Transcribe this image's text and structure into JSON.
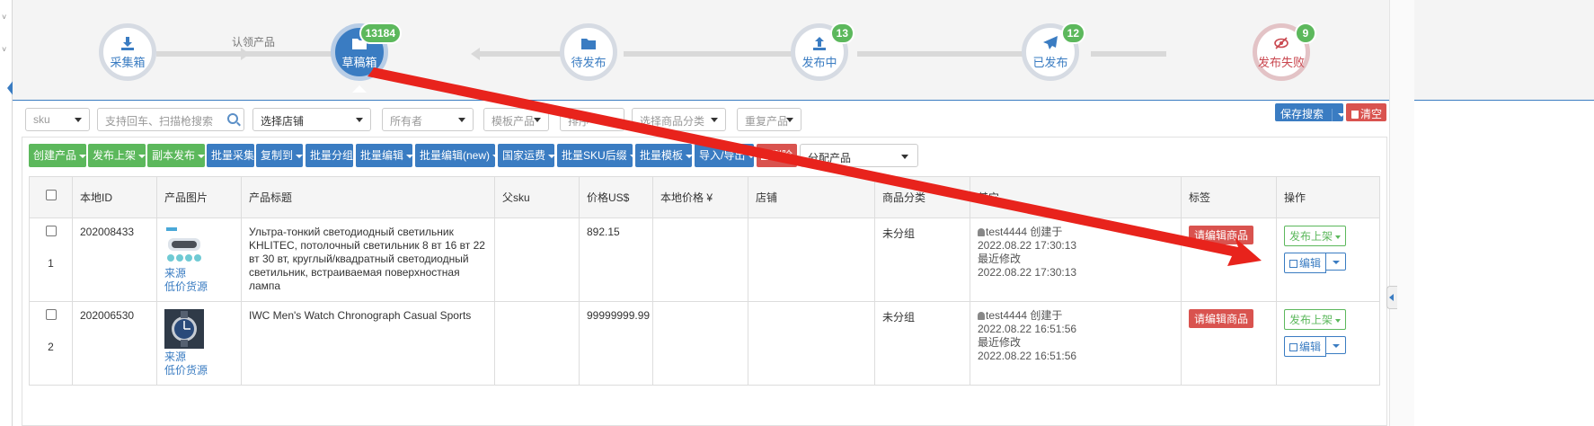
{
  "workflow": {
    "steps": [
      {
        "label": "采集箱",
        "badge": ""
      },
      {
        "label": "草稿箱",
        "badge": "13184"
      },
      {
        "label": "待发布",
        "badge": ""
      },
      {
        "label": "发布中",
        "badge": "13"
      },
      {
        "label": "已发布",
        "badge": "12"
      },
      {
        "label": "发布失败",
        "badge": "9"
      }
    ],
    "claim_label": "认领产品"
  },
  "filters": {
    "sku": "sku",
    "search_placeholder": "支持回车、扫描枪搜索",
    "store": "选择店铺",
    "owner": "所有者",
    "template": "模板产品",
    "sort": "排序",
    "category": "选择商品分类",
    "duplicate": "重复产品",
    "save_search": "保存搜索",
    "clear": "清空"
  },
  "toolbar": {
    "create": "创建产品",
    "publish": "发布上架",
    "copy_publish": "副本发布",
    "batch_collect": "批量采集",
    "copy_to": "复制到",
    "batch_group": "批量分组",
    "batch_edit": "批量编辑",
    "batch_edit_new": "批量编辑(new)",
    "shipping": "国家运费",
    "sku_suffix": "批量SKU后缀",
    "batch_template": "批量模板",
    "import_export": "导入/导出",
    "delete": "删除",
    "assign": "分配产品"
  },
  "table": {
    "headers": {
      "local_id": "本地ID",
      "image": "产品图片",
      "title": "产品标题",
      "parent_sku": "父sku",
      "price_usd": "价格US$",
      "local_price": "本地价格 ¥",
      "store": "店铺",
      "category": "商品分类",
      "other": "其它",
      "tags": "标签",
      "actions": "操作"
    },
    "rows": [
      {
        "num": "1",
        "id": "202008433",
        "source": "来源",
        "cheap": "低价货源",
        "title": "Ультра-тонкий светодиодный светильник KHLITEC, потолочный светильник 8 вт 16 вт 22 вт 30 вт, круглый/квадратный светодиодный светильник, встраиваемая поверхностная лампа",
        "parent_sku": "",
        "price": "892.15",
        "local_price": "",
        "store": "",
        "category": "未分组",
        "creator": "test4444 创建于",
        "created": "2022.08.22 17:30:13",
        "modified_label": "最近修改",
        "modified": "2022.08.22 17:30:13",
        "tag": "请编辑商品",
        "pub_btn": "发布上架",
        "edit_btn": "编辑"
      },
      {
        "num": "2",
        "id": "202006530",
        "source": "来源",
        "cheap": "低价货源",
        "title": "IWC Men's Watch Chronograph Casual Sports",
        "parent_sku": "",
        "price": "99999999.99",
        "local_price": "",
        "store": "",
        "category": "未分组",
        "creator": "test4444 创建于",
        "created": "2022.08.22 16:51:56",
        "modified_label": "最近修改",
        "modified": "2022.08.22 16:51:56",
        "tag": "请编辑商品",
        "pub_btn": "发布上架",
        "edit_btn": "编辑"
      }
    ]
  },
  "colors": {
    "primary": "#3a7cc2",
    "success": "#5cb85c",
    "danger": "#d9534f",
    "annotation": "#e8231c"
  }
}
